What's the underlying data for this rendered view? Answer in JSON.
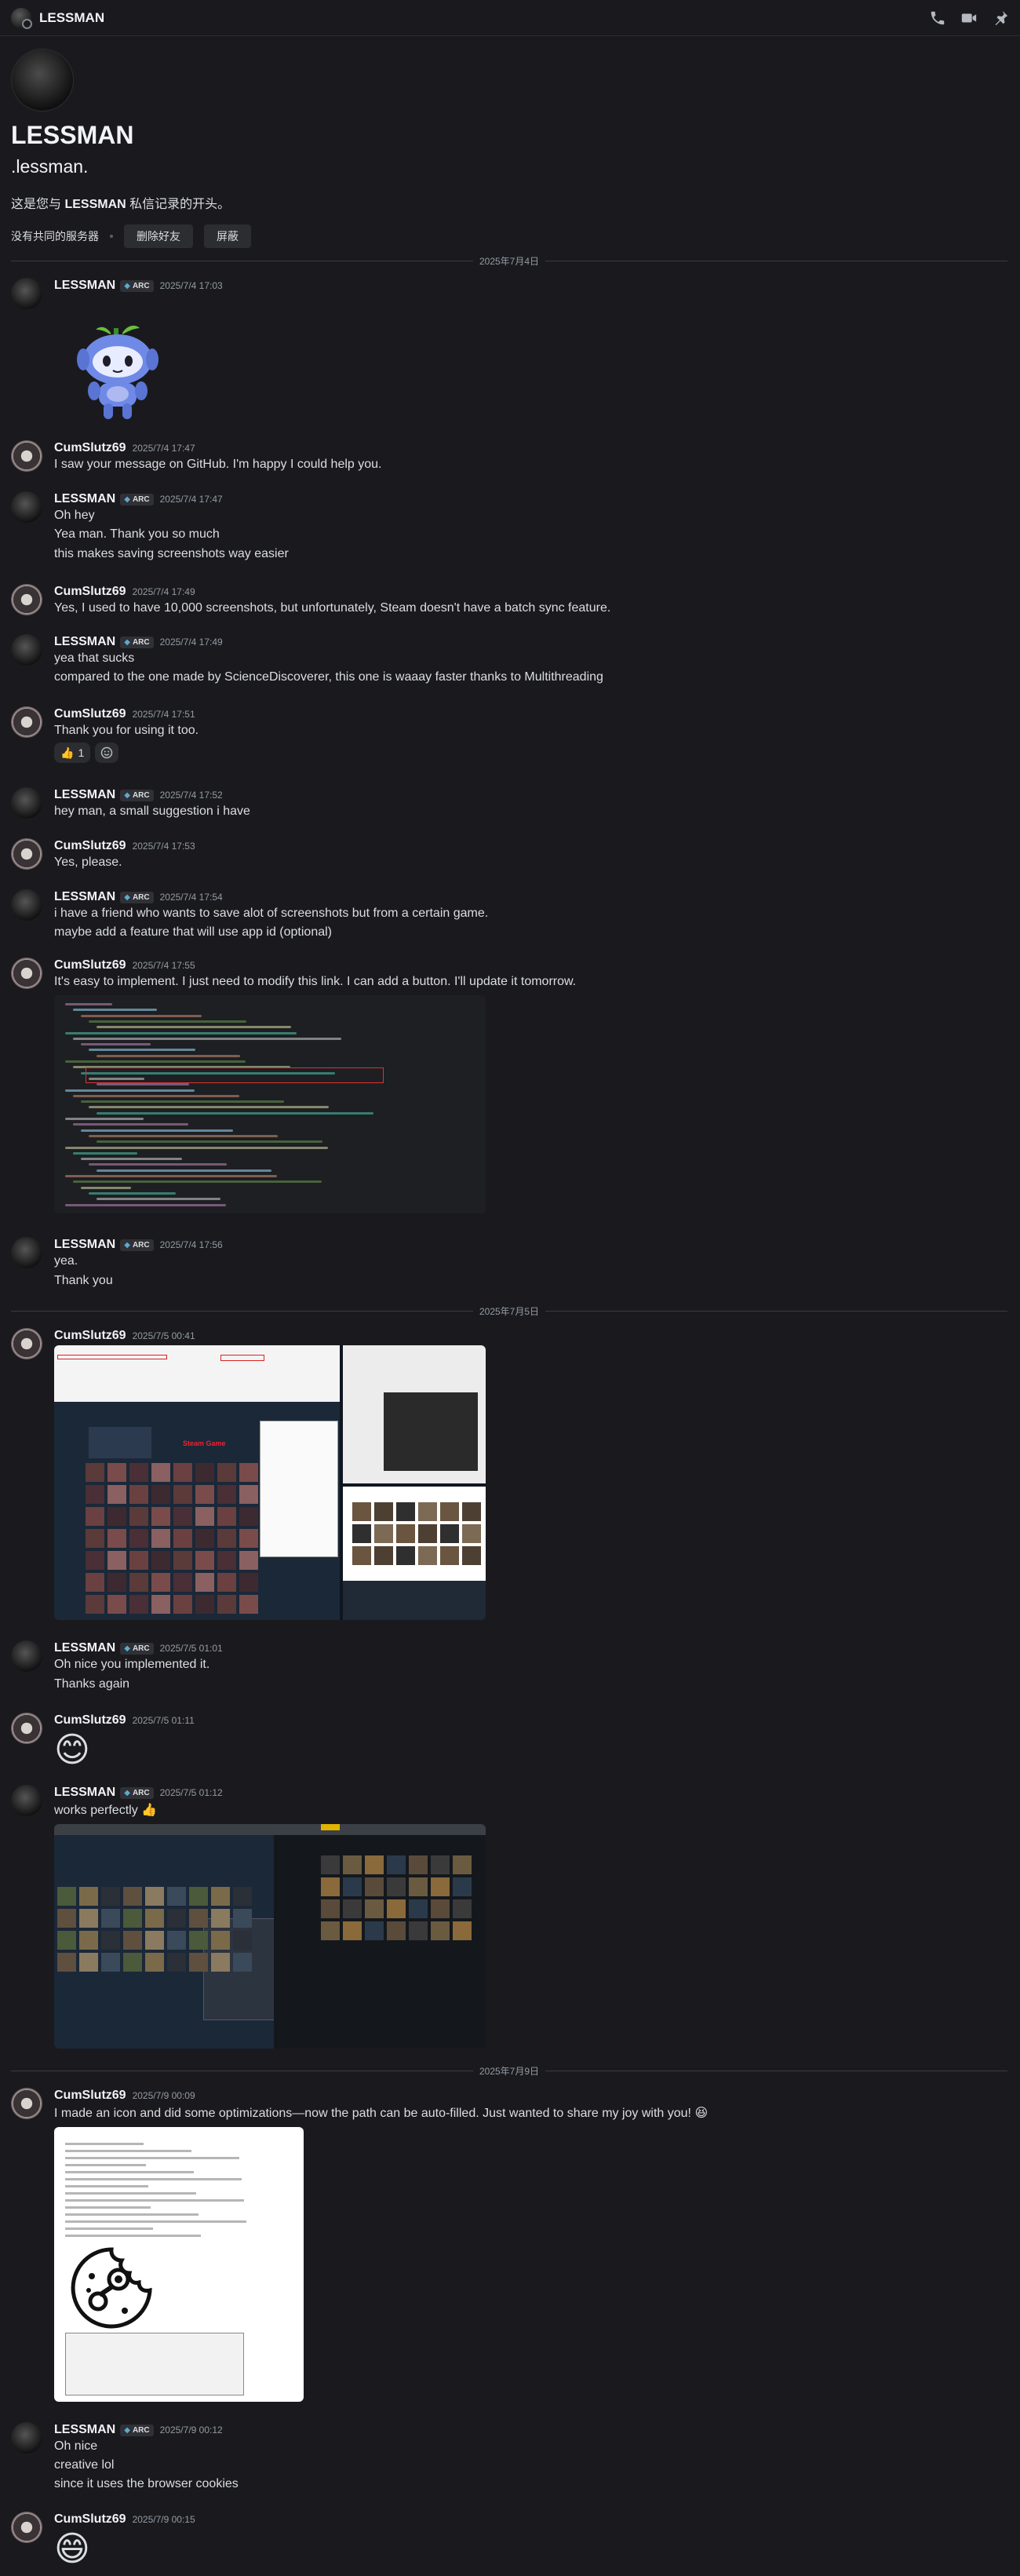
{
  "header": {
    "title": "LESSMAN",
    "icons": [
      "voice-call-icon",
      "video-call-icon",
      "pin-icon"
    ]
  },
  "profile": {
    "display_name": "LESSMAN",
    "username": ".lessman.",
    "intro_prefix": "这是您与 ",
    "intro_name": "LESSMAN",
    "intro_suffix": " 私信记录的开头。",
    "no_mutual": "没有共同的服务器",
    "remove_friend": "删除好友",
    "block": "屏蔽"
  },
  "dividers": [
    "2025年7月4日",
    "2025年7月5日",
    "2025年7月9日"
  ],
  "tag": {
    "label": "ARC",
    "color": "#5fa8d3"
  },
  "messages": [
    {
      "author": "LESSMAN",
      "tag": true,
      "time": "2025/7/4 17:03",
      "lines": []
    },
    {
      "author": "CumSlutz69",
      "tag": false,
      "time": "2025/7/4 17:47",
      "lines": [
        "I saw your message on GitHub. I'm happy I could help you."
      ]
    },
    {
      "author": "LESSMAN",
      "tag": true,
      "time": "2025/7/4 17:47",
      "lines": [
        "Oh hey",
        "Yea man. Thank you so much",
        "this makes saving screenshots way easier"
      ]
    },
    {
      "author": "CumSlutz69",
      "tag": false,
      "time": "2025/7/4 17:49",
      "lines": [
        "Yes, I used to have 10,000 screenshots, but unfortunately, Steam doesn't have a batch sync feature."
      ]
    },
    {
      "author": "LESSMAN",
      "tag": true,
      "time": "2025/7/4 17:49",
      "lines": [
        "yea that sucks",
        "compared to the one made by ScienceDiscoverer, this one is waaay faster thanks to Multithreading"
      ]
    },
    {
      "author": "CumSlutz69",
      "tag": false,
      "time": "2025/7/4 17:51",
      "lines": [
        "Thank you for using it too."
      ],
      "reaction": {
        "emoji": "👍",
        "count": "1"
      }
    },
    {
      "author": "LESSMAN",
      "tag": true,
      "time": "2025/7/4 17:52",
      "lines": [
        "hey man, a small suggestion i have"
      ]
    },
    {
      "author": "CumSlutz69",
      "tag": false,
      "time": "2025/7/4 17:53",
      "lines": [
        "Yes, please."
      ]
    },
    {
      "author": "LESSMAN",
      "tag": true,
      "time": "2025/7/4 17:54",
      "lines": [
        "i have a friend who wants to save alot of screenshots but from a certain game.",
        "maybe add a feature that will use app id (optional)"
      ]
    },
    {
      "author": "CumSlutz69",
      "tag": false,
      "time": "2025/7/4 17:55",
      "lines": [
        "It's easy to implement. I just need to modify this link. I can add a button. I'll update it tomorrow."
      ]
    },
    {
      "author": "LESSMAN",
      "tag": true,
      "time": "2025/7/4 17:56",
      "lines": [
        "yea.",
        "Thank you"
      ]
    },
    {
      "author": "CumSlutz69",
      "tag": false,
      "time": "2025/7/5 00:41",
      "lines": []
    },
    {
      "author": "LESSMAN",
      "tag": true,
      "time": "2025/7/5 01:01",
      "lines": [
        "Oh nice you implemented it.",
        "Thanks again"
      ]
    },
    {
      "author": "CumSlutz69",
      "tag": false,
      "time": "2025/7/5 01:11",
      "lines": [],
      "emoji": "😊"
    },
    {
      "author": "LESSMAN",
      "tag": true,
      "time": "2025/7/5 01:12",
      "lines": [
        "works perfectly 👍"
      ]
    },
    {
      "author": "CumSlutz69",
      "tag": false,
      "time": "2025/7/9 00:09",
      "lines": [
        "I made an icon and did some optimizations—now the path can be auto-filled. Just wanted to share my joy with you! 😆"
      ]
    },
    {
      "author": "LESSMAN",
      "tag": true,
      "time": "2025/7/9 00:12",
      "lines": [
        "Oh nice",
        "creative lol",
        "since it uses the browser cookies"
      ]
    },
    {
      "author": "CumSlutz69",
      "tag": false,
      "time": "2025/7/9 00:15",
      "lines": [],
      "emoji": "😄"
    }
  ],
  "screenshot_caption": "Steam Game"
}
